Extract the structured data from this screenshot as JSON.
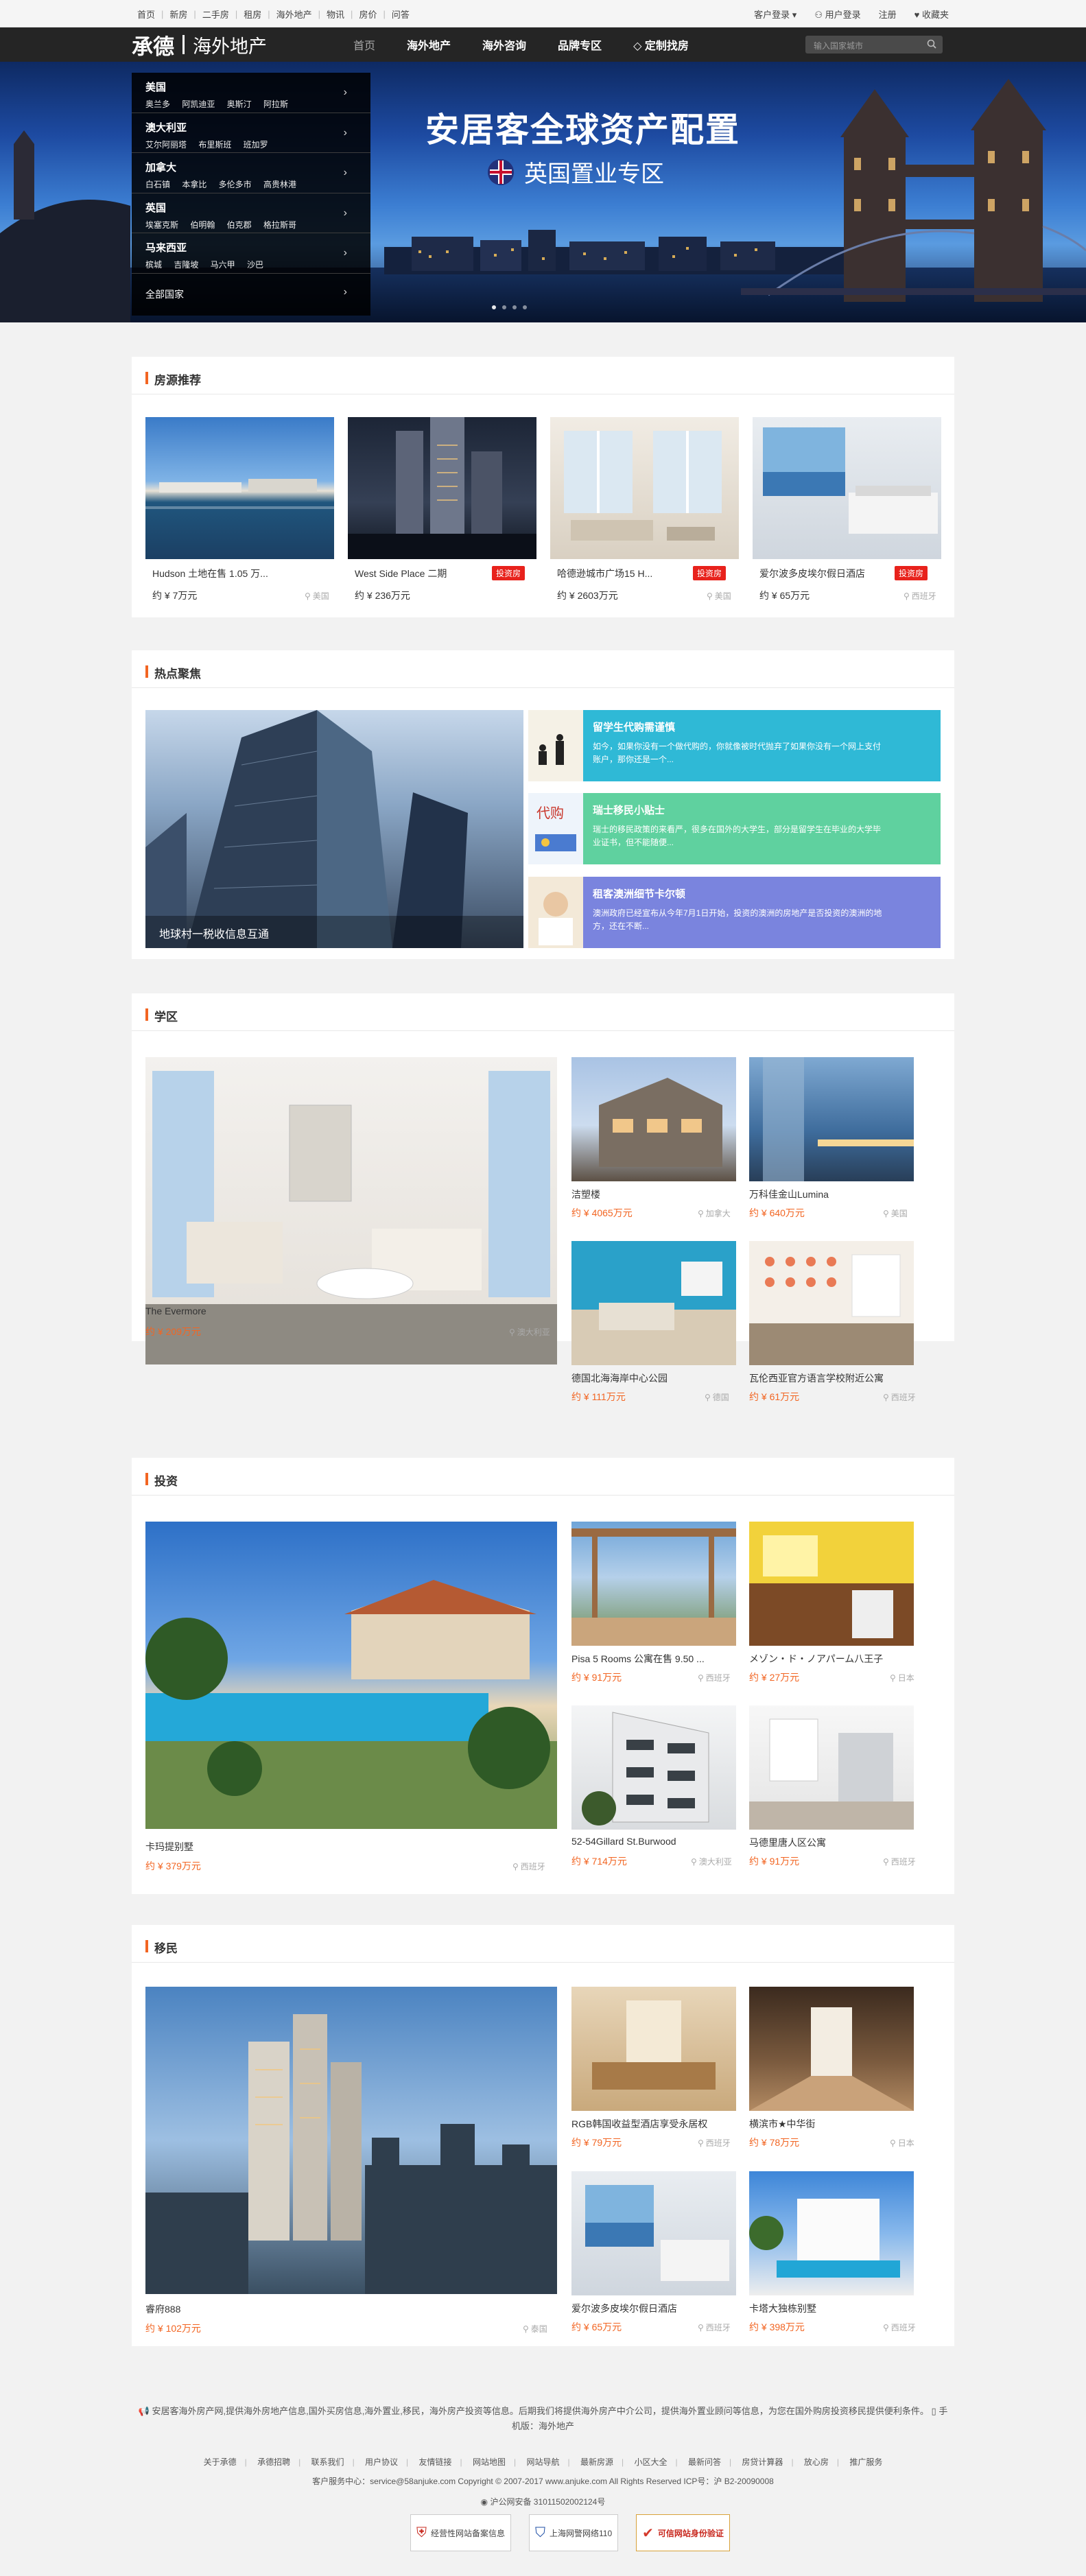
{
  "topbar": {
    "links": [
      "首页",
      "新房",
      "二手房",
      "租房",
      "海外地产",
      "物讯",
      "房价",
      "问答"
    ],
    "customer_login": "客户登录",
    "user_login": "用户登录",
    "register": "注册",
    "favorite": "收藏夹"
  },
  "header": {
    "logo_main": "承德",
    "logo_sub": "海外地产",
    "nav": [
      "首页",
      "海外地产",
      "海外咨询",
      "品牌专区",
      "定制找房"
    ],
    "search_placeholder": "输入国家城市"
  },
  "hero": {
    "title": "安居客全球资产配置",
    "subtitle": "英国置业专区",
    "menu": [
      {
        "country": "美国",
        "cities": "奥兰多 阿凯迪亚 奥斯汀 阿拉斯"
      },
      {
        "country": "澳大利亚",
        "cities": "艾尔阿丽塔 布里斯班 班加罗"
      },
      {
        "country": "加拿大",
        "cities": "白石镇 本拿比 多伦多市 高贵林港"
      },
      {
        "country": "英国",
        "cities": "埃塞克斯 伯明翰 伯克郡 格拉斯哥"
      },
      {
        "country": "马来西亚",
        "cities": "槟城 吉隆坡 马六甲 沙巴"
      },
      {
        "country": "全部国家",
        "cities": ""
      }
    ]
  },
  "listings": {
    "title": "房源推荐",
    "items": [
      {
        "name": "Hudson 土地在售 1.05 万...",
        "price": "约 ¥ 7万元",
        "loc": "美国",
        "tag": ""
      },
      {
        "name": "West Side Place 二期",
        "price": "约 ¥ 236万元",
        "loc": "",
        "tag": "投资房"
      },
      {
        "name": "哈德逊城市广场15 H...",
        "price": "约 ¥ 2603万元",
        "loc": "美国",
        "tag": "投资房"
      },
      {
        "name": "爱尔波多皮埃尔假日酒店",
        "price": "约 ¥ 65万元",
        "loc": "西班牙",
        "tag": "投资房"
      }
    ]
  },
  "hotspot": {
    "title": "热点聚焦",
    "main_caption": "地球村一税收信息互通",
    "items": [
      {
        "title": "留学生代购需谨慎",
        "text": "如今，如果你没有一个做代购的，你就像被时代抛弃了如果你没有一个网上支付账户，那你还是一个..."
      },
      {
        "title": "瑞士移民小贴士",
        "text": "瑞士的移民政策的来看严，很多在国外的大学生，部分是留学生在毕业的大学毕业证书，但不能随便..."
      },
      {
        "title": "租客澳洲细节卡尔顿",
        "text": "澳洲政府已经宣布从今年7月1日开始，投资的澳洲的房地产是否投资的澳洲的地方，还在不断..."
      }
    ]
  },
  "school": {
    "title": "学区",
    "items": [
      {
        "name": "The Evermore",
        "price": "约 ¥ 209万元",
        "loc": "澳大利亚"
      },
      {
        "name": "洁塑楼",
        "price": "约 ¥ 4065万元",
        "loc": "加拿大"
      },
      {
        "name": "万科佳金山Lumina",
        "price": "约 ¥ 640万元",
        "loc": "美国"
      },
      {
        "name": "德国北海海岸中心公园",
        "price": "约 ¥ 111万元",
        "loc": "德国"
      },
      {
        "name": "瓦伦西亚官方语言学校附近公寓",
        "price": "约 ¥ 61万元",
        "loc": "西班牙"
      }
    ]
  },
  "invest": {
    "title": "投资",
    "items": [
      {
        "name": "卡玛提别墅",
        "price": "约 ¥ 379万元",
        "loc": "西班牙"
      },
      {
        "name": "Pisa 5 Rooms 公寓在售 9.50 ...",
        "price": "约 ¥ 91万元",
        "loc": "西班牙"
      },
      {
        "name": "メゾン・ド・ノアパーム八王子",
        "price": "约 ¥ 27万元",
        "loc": "日本"
      },
      {
        "name": "52-54Gillard St.Burwood",
        "price": "约 ¥ 714万元",
        "loc": "澳大利亚"
      },
      {
        "name": "马德里唐人区公寓",
        "price": "约 ¥ 91万元",
        "loc": "西班牙"
      }
    ]
  },
  "immigrate": {
    "title": "移民",
    "items": [
      {
        "name": "睿府888",
        "price": "约 ¥ 102万元",
        "loc": "泰国"
      },
      {
        "name": "RGB韩国收益型酒店享受永居权",
        "price": "约 ¥ 79万元",
        "loc": "西班牙"
      },
      {
        "name": "横滨市★中华街",
        "price": "约 ¥ 78万元",
        "loc": "日本"
      },
      {
        "name": "爱尔波多皮埃尔假日酒店",
        "price": "约 ¥ 65万元",
        "loc": "西班牙"
      },
      {
        "name": "卡塔大独栋别墅",
        "price": "约 ¥ 398万元",
        "loc": "西班牙"
      }
    ]
  },
  "footer": {
    "about": "安居客海外房产网,提供海外房地产信息,国外买房信息,海外置业,移民，海外房产投资等信息。后期我们将提供海外房产中介公司，提供海外置业顾问等信息，为您在国外购房投资移民提供便利条件。",
    "mobile": "手机版：海外地产",
    "links": [
      "关于承德",
      "承德招聘",
      "联系我们",
      "用户协议",
      "友情链接",
      "网站地图",
      "网站导航",
      "最新房源",
      "小区大全",
      "最新问答",
      "房贷计算器",
      "放心房",
      "推广服务"
    ],
    "service": "客户服务中心：service@58anjuke.com   Copyright © 2007-2017 www.anjuke.com All Rights Reserved ICP号：沪 B2-20090008",
    "police": "沪公网安备 31011502002124号",
    "badges": [
      "经营性网站备案信息",
      "上海网警网络110",
      "可信网站身份验证"
    ]
  },
  "colors": {
    "accent": "#f26522",
    "nav_bg": "#252525",
    "tag_red": "#e8221c",
    "hot1": "#2fb9d6",
    "hot2": "#5fd19f",
    "hot3": "#7a84de"
  }
}
